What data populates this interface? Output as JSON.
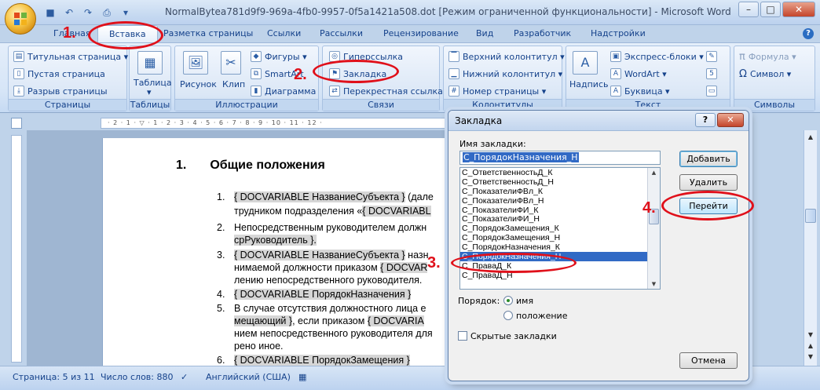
{
  "window": {
    "title": "NormalBytea781d9f9-969a-4fb0-9957-0f5a1421a508.dot [Режим ограниченной функциональности] - Microsoft Word",
    "minimize": "–",
    "maximize": "□",
    "close": "✕"
  },
  "quick_access": {
    "save": "💾",
    "undo": "↶",
    "redo": "↷",
    "more": "▾"
  },
  "tabs": [
    "Главная",
    "Вставка",
    "Разметка страницы",
    "Ссылки",
    "Рассылки",
    "Рецензирование",
    "Вид",
    "Разработчик",
    "Надстройки"
  ],
  "active_tab": "Вставка",
  "help": "?",
  "ribbon": {
    "pages": {
      "label": "Страницы",
      "items": [
        "Титульная страница ▾",
        "Пустая страница",
        "Разрыв страницы"
      ]
    },
    "tables": {
      "label": "Таблицы",
      "button": "Таблица",
      "dropdown": "▾"
    },
    "illustrations": {
      "label": "Иллюстрации",
      "picture": "Рисунок",
      "clip": "Клип",
      "shapes": "Фигуры ▾",
      "smartart": "SmartArt",
      "chart": "Диаграмма"
    },
    "links": {
      "label": "Связи",
      "hyperlink": "Гиперссылка",
      "bookmark": "Закладка",
      "crossref": "Перекрестная ссылка"
    },
    "headerfooter": {
      "label": "Колонтитулы",
      "header": "Верхний колонтитул ▾",
      "footer": "Нижний колонтитул ▾",
      "pagenum": "Номер страницы ▾"
    },
    "text": {
      "label": "Текст",
      "textbox": "Надпись",
      "quickparts": "Экспресс-блоки ▾",
      "wordart": "WordArt ▾",
      "dropcap": "Буквица ▾"
    },
    "symbols": {
      "label": "Символы",
      "equation": "Формула ▾",
      "symbol": "Символ ▾"
    }
  },
  "document": {
    "heading_num": "1.",
    "heading": "Общие положения",
    "lines": [
      {
        "num": "1.",
        "parts": [
          "{ DOCVARIABLE НазваниеСубъекта }",
          " (дале"
        ]
      },
      {
        "num": "",
        "parts": [
          "трудником подразделения «",
          "{ DOCVARIABL"
        ]
      },
      {
        "num": "2.",
        "parts": [
          "Непосредственным руководителем должн"
        ]
      },
      {
        "num": "",
        "parts": [
          "срРуководитель }."
        ]
      },
      {
        "num": "3.",
        "parts": [
          "{ DOCVARIABLE НазваниеСубъекта }",
          " назн"
        ]
      },
      {
        "num": "",
        "parts": [
          "нимаемой должности приказом ",
          "{ DOCVAR"
        ]
      },
      {
        "num": "",
        "parts": [
          "лению непосредственного руководителя."
        ]
      },
      {
        "num": "4.",
        "parts": [
          "{ DOCVARIABLE ПорядокНазначения }"
        ]
      },
      {
        "num": "5.",
        "parts": [
          "В случае отсутствия должностного лица е"
        ]
      },
      {
        "num": "",
        "parts": [
          "мещающий }",
          ", если приказом ",
          "{ DOCVARIA"
        ]
      },
      {
        "num": "",
        "parts": [
          "нием непосредственного руководителя для"
        ]
      },
      {
        "num": "",
        "parts": [
          "рено иное."
        ]
      },
      {
        "num": "6.",
        "parts": [
          "{ DOCVARIABLE ПорядокЗамещения }"
        ]
      }
    ]
  },
  "ruler_text": "· 2 · 1 · ▽ · 1 · 2 · 3 · 4 · 5 · 6 · 7 · 8 · 9 · 10 · 11 · 12 ·",
  "status": {
    "page": "Страница: 5 из 11",
    "words": "Число слов: 880",
    "lang": "Английский (США)"
  },
  "dialog": {
    "title": "Закладка",
    "help": "?",
    "close": "✕",
    "name_label": "Имя закладки:",
    "name_value": "С_ПорядокНазначения_Н",
    "items": [
      "С_ОтветственностьД_К",
      "С_ОтветственностьД_Н",
      "С_ПоказателиФВл_К",
      "С_ПоказателиФВл_Н",
      "С_ПоказателиФИ_К",
      "С_ПоказателиФИ_Н",
      "С_ПорядокЗамещения_К",
      "С_ПорядокЗамещения_Н",
      "С_ПорядокНазначения_К",
      "С_ПорядокНазначения_Н",
      "С_ПравaД_К",
      "С_ПравaД_Н"
    ],
    "selected_index": 9,
    "add": "Добавить",
    "delete": "Удалить",
    "goto": "Перейти",
    "order_label": "Порядок:",
    "order_name": "имя",
    "order_position": "положение",
    "order_selected": "имя",
    "hidden_label": "Скрытые закладки",
    "cancel": "Отмена"
  },
  "annotations": {
    "a1": "1.",
    "a2": "2.",
    "a3": "3.",
    "a4": "4."
  },
  "colors": {
    "accent": "#316ac5",
    "annotation": "#e0101a"
  }
}
